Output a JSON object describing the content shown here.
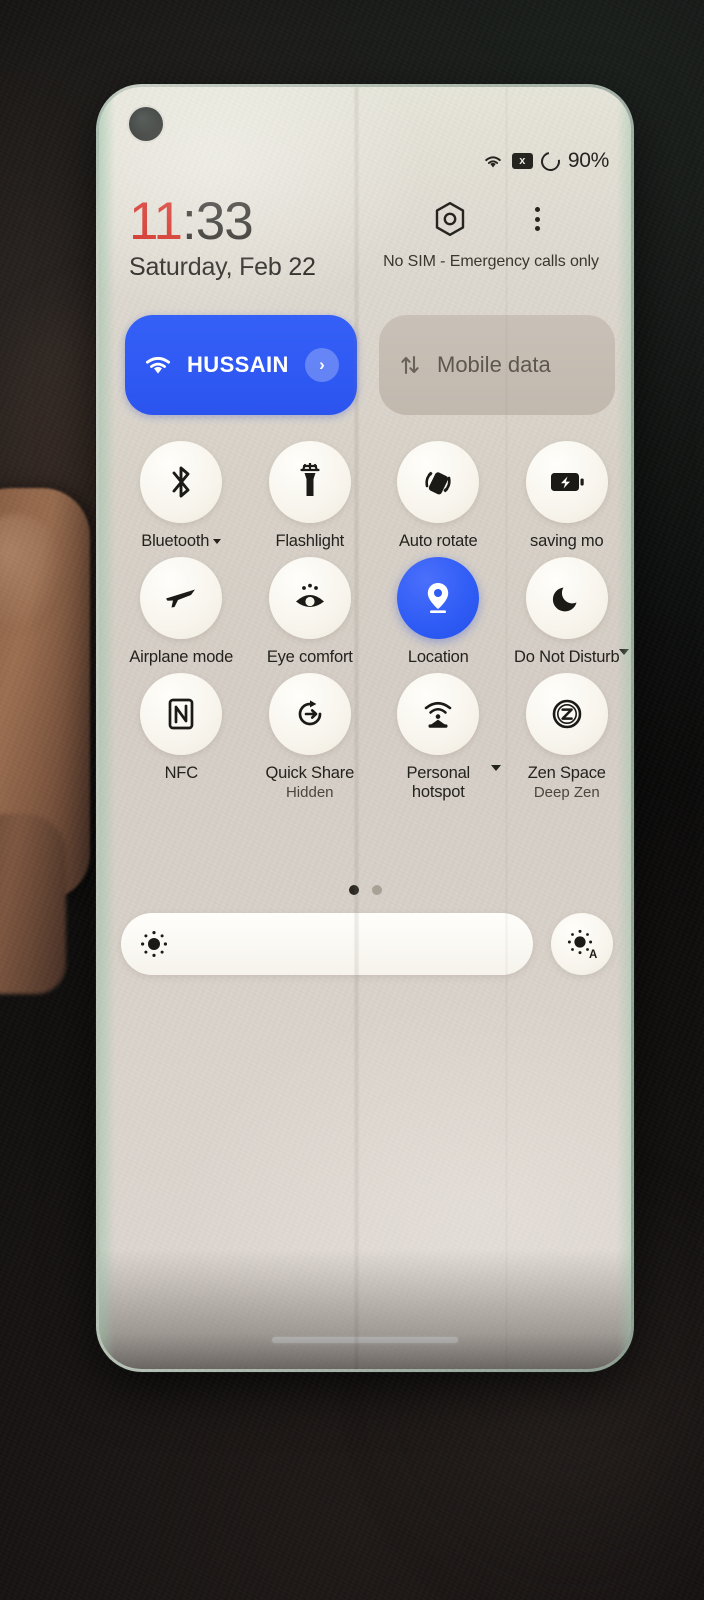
{
  "status_bar": {
    "wifi_icon": "wifi-icon",
    "no_sim_icon": "no-sim-x-icon",
    "no_sim_glyph": "x",
    "battery_icon": "battery-ring-icon",
    "battery_percent": "90%"
  },
  "header": {
    "time_hours": "11",
    "time_rest": ":33",
    "date": "Saturday, Feb 22",
    "sim_status": "No SIM - Emergency calls only",
    "settings_icon": "settings-gear-icon",
    "overflow_icon": "overflow-menu-icon"
  },
  "connectivity": {
    "wifi": {
      "label": "HUSSAIN",
      "icon": "wifi-icon",
      "chevron": "›",
      "active": true,
      "accent_color": "#2f5cf5"
    },
    "mobile_data": {
      "label": "Mobile data",
      "icon": "data-transfer-icon",
      "active": false,
      "inactive_color": "#c5bdb2"
    }
  },
  "tiles": [
    {
      "label": "Bluetooth",
      "sub": "",
      "icon": "bluetooth-icon",
      "active": false,
      "caret": "inline",
      "clipped": false
    },
    {
      "label": "Flashlight",
      "sub": "",
      "icon": "flashlight-icon",
      "active": false,
      "caret": "none",
      "clipped": false
    },
    {
      "label": "Auto rotate",
      "sub": "",
      "icon": "auto-rotate-icon",
      "active": false,
      "caret": "none",
      "clipped": false
    },
    {
      "label": "saving mo",
      "sub": "",
      "icon": "battery-saver-icon",
      "active": false,
      "caret": "none",
      "clipped": true
    },
    {
      "label": "Airplane mode",
      "sub": "",
      "icon": "airplane-icon",
      "active": false,
      "caret": "none",
      "clipped": false
    },
    {
      "label": "Eye comfort",
      "sub": "",
      "icon": "eye-comfort-icon",
      "active": false,
      "caret": "none",
      "clipped": false
    },
    {
      "label": "Location",
      "sub": "",
      "icon": "location-pin-icon",
      "active": true,
      "caret": "none",
      "clipped": false
    },
    {
      "label": "Do Not Disturb",
      "sub": "",
      "icon": "moon-icon",
      "active": false,
      "caret": "side",
      "clipped": false
    },
    {
      "label": "NFC",
      "sub": "",
      "icon": "nfc-icon",
      "active": false,
      "caret": "none",
      "clipped": false
    },
    {
      "label": "Quick Share",
      "sub": "Hidden",
      "icon": "quick-share-icon",
      "active": false,
      "caret": "none",
      "clipped": true
    },
    {
      "label": "Personal hotspot",
      "sub": "",
      "icon": "hotspot-icon",
      "active": false,
      "caret": "side",
      "clipped": false
    },
    {
      "label": "Zen Space",
      "sub": "Deep Zen",
      "icon": "zen-space-icon",
      "active": false,
      "caret": "none",
      "clipped": false
    }
  ],
  "pagination": {
    "total": 2,
    "current": 1
  },
  "brightness": {
    "slider_icon": "brightness-sun-icon",
    "auto_icon": "auto-brightness-icon",
    "auto_letter": "A",
    "level_percent": 100
  },
  "device": {
    "gesture_bar": "gesture-navigation-bar",
    "camera": "punch-hole-camera"
  }
}
